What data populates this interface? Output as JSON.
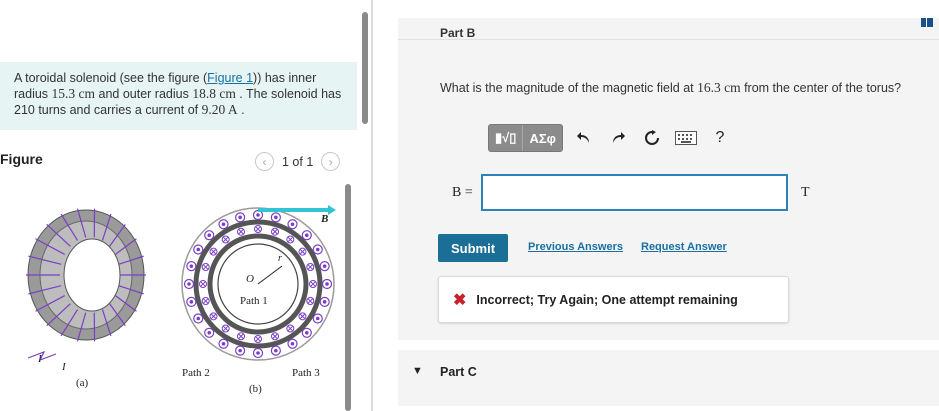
{
  "problem": {
    "text_1": "A toroidal solenoid (see the figure (",
    "figure_link": "Figure 1",
    "text_2": ")) has inner radius ",
    "inner_radius": "15.3 cm",
    "text_3": " and outer radius ",
    "outer_radius": "18.8 cm",
    "text_4": " . The solenoid has 210 turns and carries a current of ",
    "current": "9.20 A",
    "text_5": " ."
  },
  "figure": {
    "heading": "Figure",
    "pager": "1 of 1",
    "label_a": "(a)",
    "label_b": "(b)",
    "path1": "Path 1",
    "path2": "Path 2",
    "path3": "Path 3",
    "label_B": "B",
    "label_O": "O",
    "label_r": "r",
    "label_I1": "I",
    "label_I2": "I"
  },
  "part_b": {
    "header_label": "Part B",
    "question_1": "What is the magnitude of the magnetic field at ",
    "question_value": "16.3 cm",
    "question_2": " from the center of the torus?",
    "toolbar": {
      "template_btn": "▮√▯",
      "greek_btn": "ΑΣφ",
      "undo_icon": "undo-icon",
      "redo_icon": "redo-icon",
      "reset_icon": "reset-icon",
      "keyboard_icon": "keyboard-icon",
      "help_label": "?"
    },
    "answer_label": "B =",
    "answer_value": "",
    "unit": "T",
    "submit_label": "Submit",
    "previous_answers_label": "Previous Answers",
    "request_answer_label": "Request Answer",
    "feedback": "Incorrect; Try Again; One attempt remaining"
  },
  "part_c": {
    "label": "Part C"
  },
  "colors": {
    "accent": "#1b6e95",
    "link": "#1a6fa3",
    "input_border": "#2d83b7",
    "error": "#c8202a",
    "problem_bg": "#e6f4f4",
    "panel_bg": "#f4f4f4"
  }
}
